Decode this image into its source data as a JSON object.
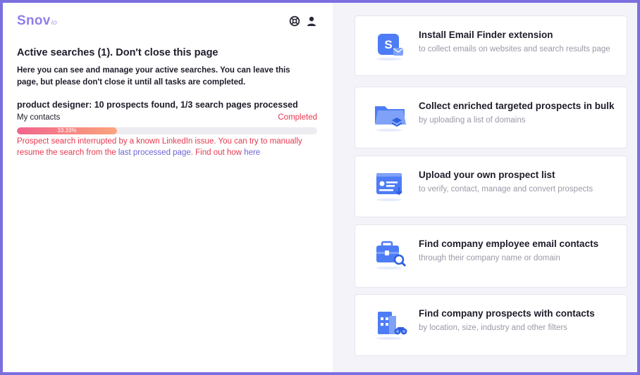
{
  "app": {
    "logo": "Snov",
    "logo_suffix": "io"
  },
  "header_icons": [
    "support-icon",
    "user-icon"
  ],
  "active": {
    "title": "Active searches (1). Don't close this page",
    "description": "Here you can see and manage your active searches. You can leave this page, but please don't close it until all tasks are completed.",
    "task": {
      "title": "product designer: 10 prospects found, 1/3 search pages processed",
      "list_name": "My contacts",
      "status": "Completed",
      "progress_label": "33.33%",
      "progress": 33.33,
      "error_text": "Prospect search interrupted by a known LinkedIn issue. You can try to manually resume the search from the ",
      "error_link": "last processed page",
      "error_mid": ". Find out how ",
      "error_link2": "here"
    }
  },
  "cards": [
    {
      "title": "Install Email Finder extension",
      "subtitle": "to collect emails on websites and search results page",
      "icon": "extension-icon"
    },
    {
      "title": "Collect enriched targeted prospects in bulk",
      "subtitle": "by uploading a list of domains",
      "icon": "folder-layers-icon"
    },
    {
      "title": "Upload your own prospect list",
      "subtitle": "to verify, contact, manage and convert prospects",
      "icon": "upload-list-icon"
    },
    {
      "title": "Find company employee email contacts",
      "subtitle": "through their company name or domain",
      "icon": "briefcase-search-icon"
    },
    {
      "title": "Find company prospects with contacts",
      "subtitle": "by location, size, industry and other filters",
      "icon": "building-binoculars-icon"
    }
  ],
  "colors": {
    "accent": "#7b6fe0",
    "error": "#e5384f",
    "icon_blue": "#4d7cf6",
    "link": "#6d63d6"
  }
}
